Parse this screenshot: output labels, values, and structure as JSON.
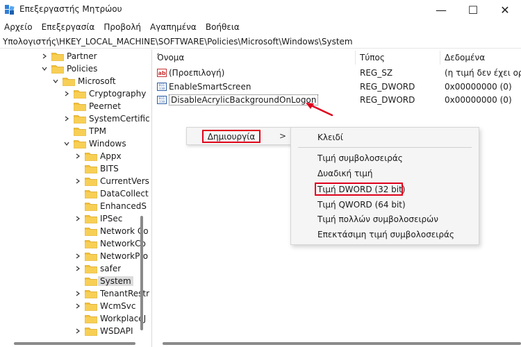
{
  "window": {
    "title": "Επεξεργαστής Μητρώου",
    "min_glyph": "—",
    "max_glyph": "☐",
    "close_glyph": "✕"
  },
  "menu": [
    "Αρχείο",
    "Επεξεργασία",
    "Προβολή",
    "Αγαπημένα",
    "Βοήθεια"
  ],
  "address": "Υπολογιστής\\HKEY_LOCAL_MACHINE\\SOFTWARE\\Policies\\Microsoft\\Windows\\System",
  "tree": [
    {
      "label": "Partner",
      "chevron": ">"
    },
    {
      "label": "Policies",
      "chevron": "v"
    },
    {
      "label": "Microsoft",
      "chevron": "v"
    },
    {
      "label": "Cryptography",
      "chevron": ">"
    },
    {
      "label": "Peernet",
      "chevron": ""
    },
    {
      "label": "SystemCertific",
      "chevron": ">"
    },
    {
      "label": "TPM",
      "chevron": ""
    },
    {
      "label": "Windows",
      "chevron": "v"
    },
    {
      "label": "Appx",
      "chevron": ">"
    },
    {
      "label": "BITS",
      "chevron": ""
    },
    {
      "label": "CurrentVers",
      "chevron": ">"
    },
    {
      "label": "DataCollect",
      "chevron": ""
    },
    {
      "label": "EnhancedS",
      "chevron": ""
    },
    {
      "label": "IPSec",
      "chevron": ">"
    },
    {
      "label": "Network Co",
      "chevron": ""
    },
    {
      "label": "NetworkCo",
      "chevron": ""
    },
    {
      "label": "NetworkPro",
      "chevron": ">"
    },
    {
      "label": "safer",
      "chevron": ">"
    },
    {
      "label": "System",
      "chevron": ""
    },
    {
      "label": "TenantRestr",
      "chevron": ">"
    },
    {
      "label": "WcmSvc",
      "chevron": ">"
    },
    {
      "label": "WorkplaceJ",
      "chevron": ""
    },
    {
      "label": "WSDAPI",
      "chevron": ">"
    }
  ],
  "columns": {
    "name": "Όνομα",
    "type": "Τύπος",
    "data": "Δεδομένα"
  },
  "values": [
    {
      "icon": "ab",
      "name": "(Προεπιλογή)",
      "type": "REG_SZ",
      "data": "(η τιμή δεν έχει ορισ"
    },
    {
      "icon": "dword",
      "name": "EnableSmartScreen",
      "type": "REG_DWORD",
      "data": "0x00000000 (0)"
    },
    {
      "icon": "dword",
      "name": "DisableAcrylicBackgroundOnLogon",
      "type": "REG_DWORD",
      "data": "0x00000000 (0)"
    }
  ],
  "context_menu": {
    "new_label": "Δημιουργία",
    "arrow": ">"
  },
  "submenu": {
    "key": "Κλειδί",
    "string": "Τιμή συμβολοσειράς",
    "binary": "Δυαδική τιμή",
    "dword": "Τιμή DWORD (32 bit)",
    "qword": "Τιμή QWORD (64 bit)",
    "multi": "Τιμή πολλών συμβολοσειρών",
    "expand": "Επεκτάσιμη τιμή συμβολοσειράς"
  },
  "colors": {
    "annotation_red": "#e0001b",
    "folder_yellow": "#f3c13a",
    "selection": "#dcdcdc"
  }
}
